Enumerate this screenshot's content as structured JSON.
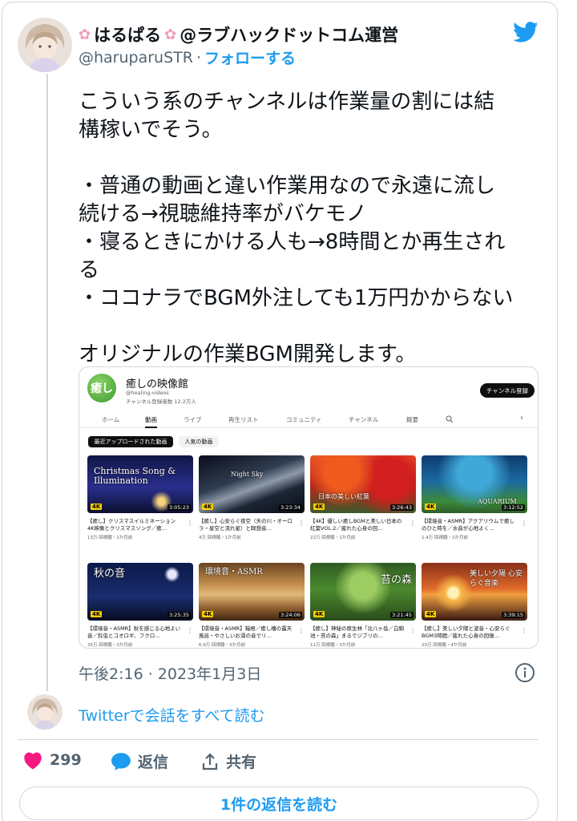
{
  "author": {
    "display_name": "はるぱる",
    "display_name_suffix": "@ラブハックドットコム運営",
    "handle": "@haruparuSTR",
    "separator": "·",
    "follow_label": "フォローする"
  },
  "tweet": {
    "lines": [
      "こういう系のチャンネルは作業量の割には結",
      "構稼いでそう。",
      "",
      "・普通の動画と違い作業用なので永遠に流し",
      "続ける→視聴維持率がバケモノ",
      "・寝るときにかける人も→8時間とか再生され",
      "る",
      "・ココナラでBGM外注しても1万円かからない",
      "",
      "オリジナルの作業BGM開発します。"
    ],
    "timestamp": "午後2:16 · 2023年1月3日"
  },
  "embed": {
    "logo_text": "癒し",
    "channel_name": "癒しの映像館",
    "channel_id": "@healing-videos",
    "subscribers": "チャンネル登録者数 12.2万人",
    "subscribe_label": "チャンネル登録",
    "tabs": [
      "ホーム",
      "動画",
      "ライブ",
      "再生リスト",
      "コミュニティ",
      "チャンネル",
      "概要"
    ],
    "active_tab": "動画",
    "chips": [
      "最近アップロードされた動画",
      "人気の動画"
    ],
    "videos": [
      {
        "thumb_text": "Christmas Song & Illumination",
        "badge": "4K",
        "duration": "3:05:23",
        "title": "【癒し】クリスマスイルミネーション4K映像とクリスマスソング／癒…",
        "meta": "13万 回視聴・1か月前"
      },
      {
        "thumb_text": "Night Sky",
        "badge": "4K",
        "duration": "3:23:34",
        "title": "【癒し】心安らぐ夜空（天の川・オーロラ・星空と流れ星）と瞑想音…",
        "meta": "4万 回視聴・1か月前"
      },
      {
        "thumb_text": "日本の美しい紅葉",
        "badge": "4K",
        "duration": "3:26:43",
        "title": "【4K】優しい癒しBGMと美しい日本の紅葉VOL.2／疲れた心身の回…",
        "meta": "22万 回視聴・1か月前"
      },
      {
        "thumb_text": "AQUARIUM",
        "badge": "4K",
        "duration": "3:12:52",
        "title": "【環境音・ASMR】アクアリウムで癒しのひと時を／水音が心地よく…",
        "meta": "1.4万 回視聴・2か月前"
      },
      {
        "thumb_text": "秋の音",
        "badge": "4K",
        "duration": "3:25:35",
        "title": "【環境音・ASMR】秋を感じる心地よい音／鈴虫とコオロギ、フクロ…",
        "meta": "35万 回視聴・3か月前"
      },
      {
        "thumb_text": "環境音・ASMR",
        "badge": "4K",
        "duration": "3:24:06",
        "title": "【環境音・ASMR】箱根／癒し檜の露天風呂・やさしいお湯の音でリ…",
        "meta": "6.9万 回視聴・3か月前"
      },
      {
        "thumb_text": "苔の森",
        "badge": "4K",
        "duration": "3:21:45",
        "title": "【癒し】神秘の原生林「北八ヶ岳／白駒池・苔の森」まるでジブリの…",
        "meta": "11万 回視聴・3か月前"
      },
      {
        "thumb_text": "美しい夕陽 心安らぐ音楽",
        "badge": "4K",
        "duration": "3:39:15",
        "title": "【癒し】美しい夕陽と波音・心安らぐBGM3時間／疲れた心身の回復…",
        "meta": "20万 回視聴・4か月前"
      }
    ]
  },
  "read_conversation_label": "Twitterで会話をすべて読む",
  "actions": {
    "like_count": "299",
    "reply_label": "返信",
    "share_label": "共有"
  },
  "read_replies_label": "1件の返信を読む",
  "colors": {
    "accent": "#1d9bf0",
    "like": "#f91880",
    "secondary_text": "#536471",
    "border": "#cfd9de"
  }
}
